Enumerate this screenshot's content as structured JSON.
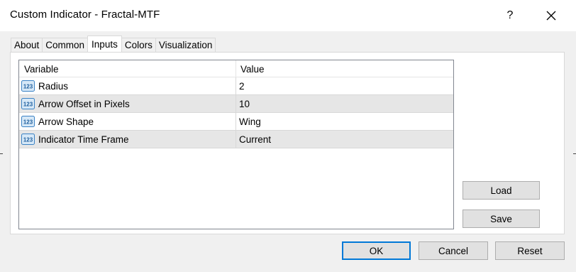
{
  "window": {
    "title": "Custom Indicator - Fractal-MTF",
    "help_label": "?"
  },
  "tabs": [
    {
      "label": "About"
    },
    {
      "label": "Common"
    },
    {
      "label": "Inputs"
    },
    {
      "label": "Colors"
    },
    {
      "label": "Visualization"
    }
  ],
  "active_tab": "Inputs",
  "inputs_table": {
    "columns": [
      "Variable",
      "Value"
    ],
    "rows": [
      {
        "icon": "number-type-icon",
        "variable": "Radius",
        "value": "2"
      },
      {
        "icon": "number-type-icon",
        "variable": "Arrow Offset in Pixels",
        "value": "10"
      },
      {
        "icon": "number-type-icon",
        "variable": "Arrow Shape",
        "value": "Wing"
      },
      {
        "icon": "number-type-icon",
        "variable": "Indicator Time Frame",
        "value": "Current"
      }
    ]
  },
  "side_buttons": {
    "load": "Load",
    "save": "Save"
  },
  "footer_buttons": {
    "ok": "OK",
    "cancel": "Cancel",
    "reset": "Reset"
  },
  "colors": {
    "accent": "#0078d7",
    "icon_blue": "#3b82c4"
  }
}
